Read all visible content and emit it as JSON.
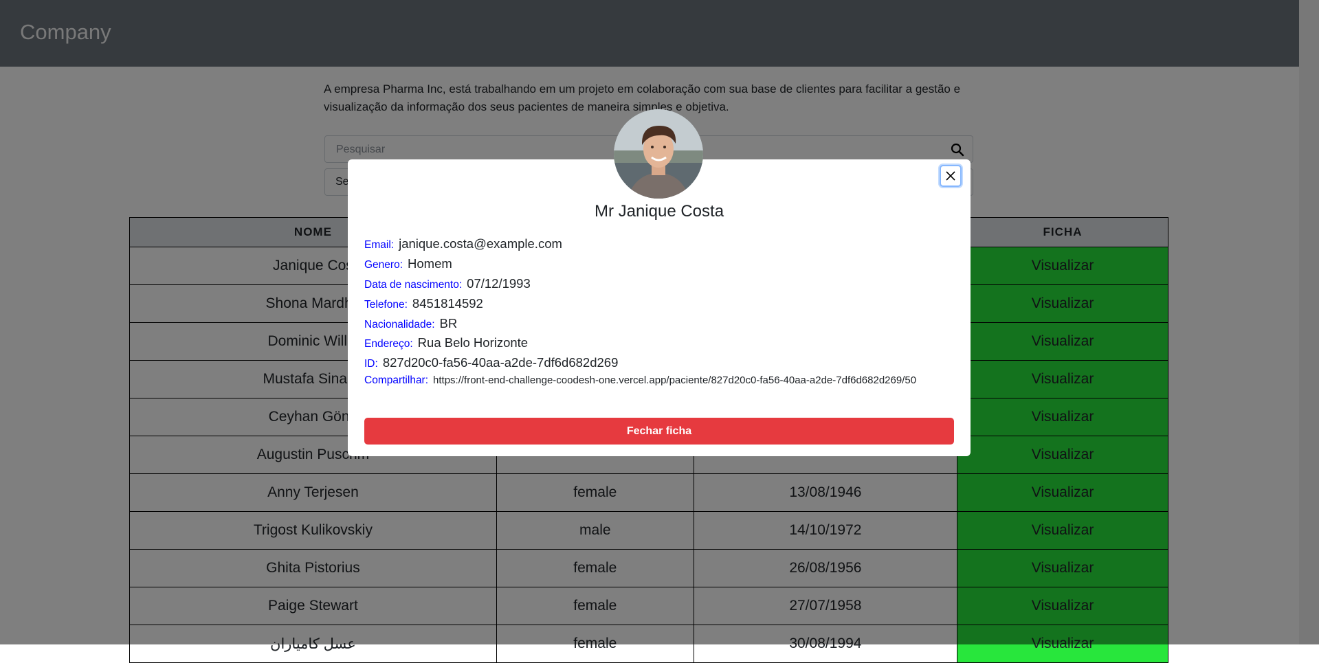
{
  "header": {
    "brand": "Company"
  },
  "intro": "A empresa Pharma Inc, está trabalhando em um projeto em colaboração com sua base de clientes para facilitar a gestão e visualização da informação dos seus pacientes de maneira simples e objetiva.",
  "search": {
    "placeholder": "Pesquisar",
    "icon": "search-icon"
  },
  "filter": {
    "visible_text": "Se"
  },
  "table": {
    "headers": {
      "name": "NOME",
      "sheet": "FICHA"
    },
    "rows": [
      {
        "name": "Janique Cos",
        "gender": "",
        "birth": "",
        "action": "Visualizar"
      },
      {
        "name": "Shona Mardhe",
        "gender": "",
        "birth": "",
        "action": "Visualizar"
      },
      {
        "name": "Dominic Willia",
        "gender": "",
        "birth": "",
        "action": "Visualizar"
      },
      {
        "name": "Mustafa Sinano",
        "gender": "",
        "birth": "",
        "action": "Visualizar"
      },
      {
        "name": "Ceyhan Gönü",
        "gender": "",
        "birth": "",
        "action": "Visualizar"
      },
      {
        "name": "Augustin Puschm",
        "gender": "",
        "birth": "",
        "action": "Visualizar"
      },
      {
        "name": "Anny Terjesen",
        "gender": "female",
        "birth": "13/08/1946",
        "action": "Visualizar"
      },
      {
        "name": "Trigost Kulikovskiy",
        "gender": "male",
        "birth": "14/10/1972",
        "action": "Visualizar"
      },
      {
        "name": "Ghita Pistorius",
        "gender": "female",
        "birth": "26/08/1956",
        "action": "Visualizar"
      },
      {
        "name": "Paige Stewart",
        "gender": "female",
        "birth": "27/07/1958",
        "action": "Visualizar"
      },
      {
        "name": "عسل کامیاران",
        "gender": "female",
        "birth": "30/08/1994",
        "action": "Visualizar"
      }
    ]
  },
  "modal": {
    "name": "Mr Janique Costa",
    "avatar": "avatar-photo",
    "close_icon": "close-icon",
    "fields": [
      {
        "label": "Email:",
        "value": "janique.costa@example.com"
      },
      {
        "label": "Genero:",
        "value": "Homem"
      },
      {
        "label": "Data de nascimento:",
        "value": "07/12/1993"
      },
      {
        "label": "Telefone:",
        "value": "8451814592"
      },
      {
        "label": "Nacionalidade:",
        "value": "BR"
      },
      {
        "label": "Endereço:",
        "value": "Rua Belo Horizonte"
      },
      {
        "label": "ID:",
        "value": "827d20c0-fa56-40aa-a2de-7df6d682d269"
      },
      {
        "label": "Compartilhar:",
        "value": "https://front-end-challenge-coodesh-one.vercel.app/paciente/827d20c0-fa56-40aa-a2de-7df6d682d269/50"
      }
    ],
    "close_label": "Fechar ficha"
  },
  "colors": {
    "header_bg": "#6c757d",
    "action_green": "#28e63c",
    "danger_red": "#e63a3f",
    "label_blue": "#0000ff"
  }
}
